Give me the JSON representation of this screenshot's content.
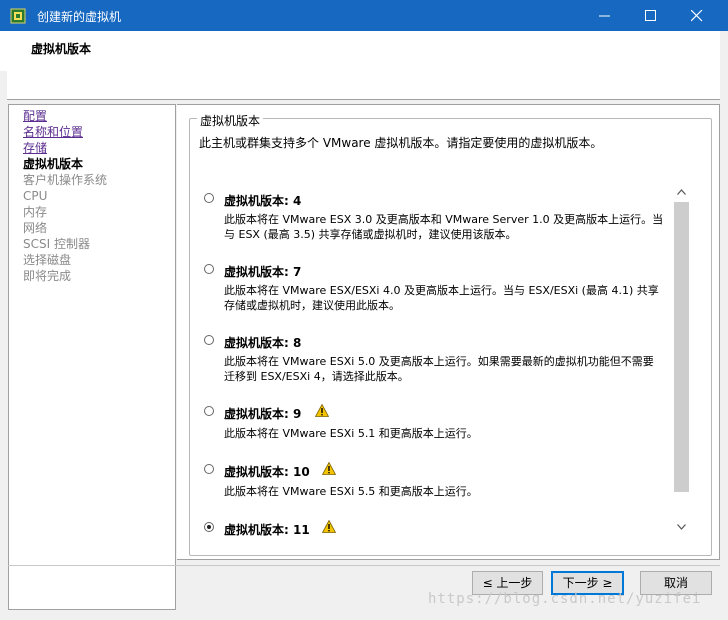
{
  "window": {
    "title": "创建新的虚拟机",
    "minimize": "—",
    "maximize": "☐",
    "close": "✕"
  },
  "header": {
    "title": "虚拟机版本"
  },
  "nav": {
    "items": [
      {
        "label": "配置",
        "state": "link"
      },
      {
        "label": "名称和位置",
        "state": "link"
      },
      {
        "label": "存储",
        "state": "link"
      },
      {
        "label": "虚拟机版本",
        "state": "current"
      },
      {
        "label": "客户机操作系统",
        "state": "disabled"
      },
      {
        "label": "CPU",
        "state": "disabled"
      },
      {
        "label": "内存",
        "state": "disabled"
      },
      {
        "label": "网络",
        "state": "disabled"
      },
      {
        "label": "SCSI 控制器",
        "state": "disabled"
      },
      {
        "label": "选择磁盘",
        "state": "disabled"
      },
      {
        "label": "即将完成",
        "state": "disabled"
      }
    ]
  },
  "main": {
    "group_label": "虚拟机版本",
    "intro": "此主机或群集支持多个 VMware 虚拟机版本。请指定要使用的虚拟机版本。",
    "options": [
      {
        "title": "虚拟机版本: 4",
        "selected": false,
        "warning": false,
        "desc": "此版本将在 VMware ESX 3.0 及更高版本和 VMware Server 1.0 及更高版本上运行。当与 ESX (最高 3.5) 共享存储或虚拟机时，建议使用该版本。"
      },
      {
        "title": "虚拟机版本: 7",
        "selected": false,
        "warning": false,
        "desc": "此版本将在 VMware ESX/ESXi 4.0 及更高版本上运行。当与 ESX/ESXi (最高 4.1) 共享存储或虚拟机时，建议使用此版本。"
      },
      {
        "title": "虚拟机版本: 8",
        "selected": false,
        "warning": false,
        "desc": "此版本将在 VMware ESXi 5.0 及更高版本上运行。如果需要最新的虚拟机功能但不需要迁移到 ESX/ESXi 4，请选择此版本。"
      },
      {
        "title": "虚拟机版本: 9",
        "selected": false,
        "warning": true,
        "desc": "此版本将在 VMware ESXi 5.1 和更高版本上运行。"
      },
      {
        "title": "虚拟机版本: 10",
        "selected": false,
        "warning": true,
        "desc": "此版本将在 VMware ESXi 5.5 和更高版本上运行。"
      },
      {
        "title": "虚拟机版本: 11",
        "selected": true,
        "warning": true,
        "desc": ""
      }
    ]
  },
  "footer": {
    "back": "≤ 上一步",
    "next": "下一步 ≥",
    "cancel": "取消"
  },
  "watermark": "https://blog.csdn.net/yuzifei",
  "colors": {
    "titlebar": "#1668c1",
    "link": "#5b2d91",
    "warning": "#f5c400"
  }
}
